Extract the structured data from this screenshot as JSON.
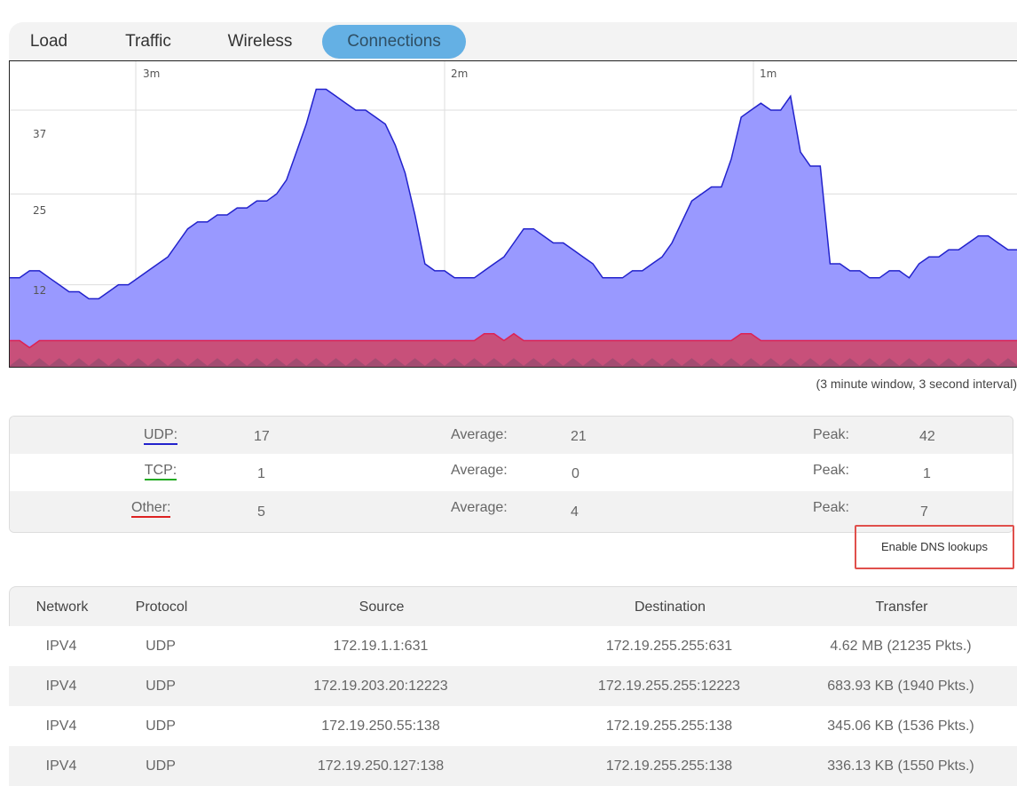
{
  "tabs": [
    {
      "label": "Load",
      "active": false
    },
    {
      "label": "Traffic",
      "active": false
    },
    {
      "label": "Wireless",
      "active": false
    },
    {
      "label": "Connections",
      "active": true
    }
  ],
  "graph": {
    "time_labels": [
      "3m",
      "2m",
      "1m"
    ],
    "y_labels": [
      "37",
      "25",
      "12"
    ],
    "caption": "(3 minute window, 3 second interval)",
    "colors": {
      "udp_fill": "#9999ff",
      "udp_line": "#2222cc",
      "other_fill": "#c8507a",
      "other_line": "#dd2255",
      "tcp_fill": "#8a4a6a"
    }
  },
  "chart_data": {
    "type": "area",
    "title": "",
    "ylim": [
      0,
      44
    ],
    "x_unit": "seconds ago",
    "series": [
      {
        "name": "UDP",
        "values": [
          13,
          13,
          14,
          14,
          13,
          12,
          11,
          11,
          10,
          10,
          11,
          12,
          12,
          13,
          14,
          15,
          16,
          18,
          20,
          21,
          21,
          22,
          22,
          23,
          23,
          24,
          24,
          25,
          27,
          31,
          35,
          40,
          40,
          39,
          38,
          37,
          37,
          36,
          35,
          32,
          28,
          22,
          15,
          14,
          14,
          13,
          13,
          13,
          14,
          15,
          16,
          18,
          20,
          20,
          19,
          18,
          18,
          17,
          16,
          15,
          13,
          13,
          13,
          14,
          14,
          15,
          16,
          18,
          21,
          24,
          25,
          26,
          26,
          30,
          36,
          37,
          38,
          37,
          37,
          39,
          31,
          29,
          29,
          15,
          15,
          14,
          14,
          13,
          13,
          14,
          14,
          13,
          15,
          16,
          16,
          17,
          17,
          18,
          19,
          19,
          18,
          17,
          17
        ]
      },
      {
        "name": "Other",
        "values": [
          4,
          4,
          3,
          4,
          4,
          4,
          4,
          4,
          4,
          4,
          4,
          4,
          4,
          4,
          4,
          4,
          4,
          4,
          4,
          4,
          4,
          4,
          4,
          4,
          4,
          4,
          4,
          4,
          4,
          4,
          4,
          4,
          4,
          4,
          4,
          4,
          4,
          4,
          4,
          4,
          4,
          4,
          4,
          4,
          4,
          4,
          4,
          4,
          5,
          5,
          4,
          5,
          4,
          4,
          4,
          4,
          4,
          4,
          4,
          4,
          4,
          4,
          4,
          4,
          4,
          4,
          4,
          4,
          4,
          4,
          4,
          4,
          4,
          4,
          5,
          5,
          4,
          4,
          4,
          4,
          4,
          4,
          4,
          4,
          4,
          4,
          4,
          4,
          4,
          4,
          4,
          4,
          4,
          4,
          4,
          4,
          4,
          4,
          4,
          4,
          4,
          4,
          4
        ]
      }
    ]
  },
  "stats": [
    {
      "label": "UDP:",
      "color": "#2222cc",
      "current": "17",
      "avg_label": "Average:",
      "avg": "21",
      "peak_label": "Peak:",
      "peak": "42"
    },
    {
      "label": "TCP:",
      "color": "#22aa22",
      "current": "1",
      "avg_label": "Average:",
      "avg": "0",
      "peak_label": "Peak:",
      "peak": "1"
    },
    {
      "label": "Other:",
      "color": "#dd2222",
      "current": "5",
      "avg_label": "Average:",
      "avg": "4",
      "peak_label": "Peak:",
      "peak": "7"
    }
  ],
  "dns_button": "Enable DNS lookups",
  "table": {
    "headers": [
      "Network",
      "Protocol",
      "Source",
      "Destination",
      "Transfer"
    ],
    "rows": [
      [
        "IPV4",
        "UDP",
        "172.19.1.1:631",
        "172.19.255.255:631",
        "4.62 MB (21235 Pkts.)"
      ],
      [
        "IPV4",
        "UDP",
        "172.19.203.20:12223",
        "172.19.255.255:12223",
        "683.93 KB (1940 Pkts.)"
      ],
      [
        "IPV4",
        "UDP",
        "172.19.250.55:138",
        "172.19.255.255:138",
        "345.06 KB (1536 Pkts.)"
      ],
      [
        "IPV4",
        "UDP",
        "172.19.250.127:138",
        "172.19.255.255:138",
        "336.13 KB (1550 Pkts.)"
      ]
    ]
  }
}
